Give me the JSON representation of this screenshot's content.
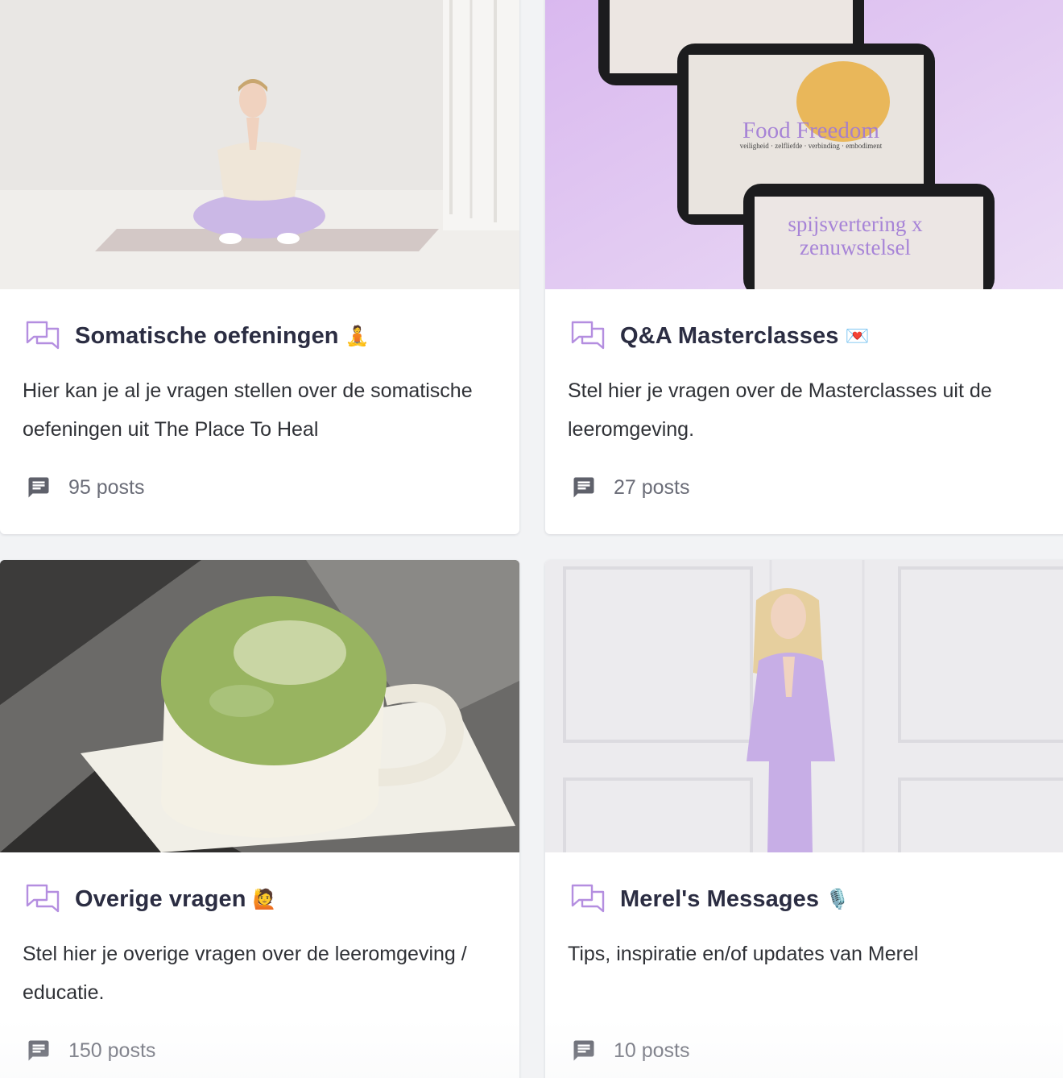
{
  "channels": [
    {
      "title": "Somatische oefeningen",
      "emoji": "🧘",
      "description": "Hier kan je al je vragen stellen over de somatische oefeningen uit The Place To Heal",
      "post_count": "95 posts"
    },
    {
      "title": "Q&A Masterclasses",
      "emoji": "💌",
      "description": "Stel hier je vragen over de Masterclasses uit de leeromgeving.",
      "post_count": "27 posts",
      "cover_text": {
        "headline": "Food Freedom",
        "subline": "veiligheid · zelfliefde · verbinding · embodiment",
        "headline_2": "spijsvertering x zenuwstelsel"
      }
    },
    {
      "title": "Overige vragen",
      "emoji": "🙋",
      "description": "Stel hier je overige vragen over de leeromgeving / educatie.",
      "post_count": "150 posts"
    },
    {
      "title": "Merel's Messages",
      "emoji": "🎙️",
      "description": "Tips, inspiratie en/of updates van Merel",
      "post_count": "10 posts"
    }
  ],
  "icons": {
    "channel": "forum-icon",
    "posts": "message-icon"
  },
  "colors": {
    "accent": "#b48ee0",
    "title": "#2b2d42",
    "muted": "#6b6d78"
  }
}
